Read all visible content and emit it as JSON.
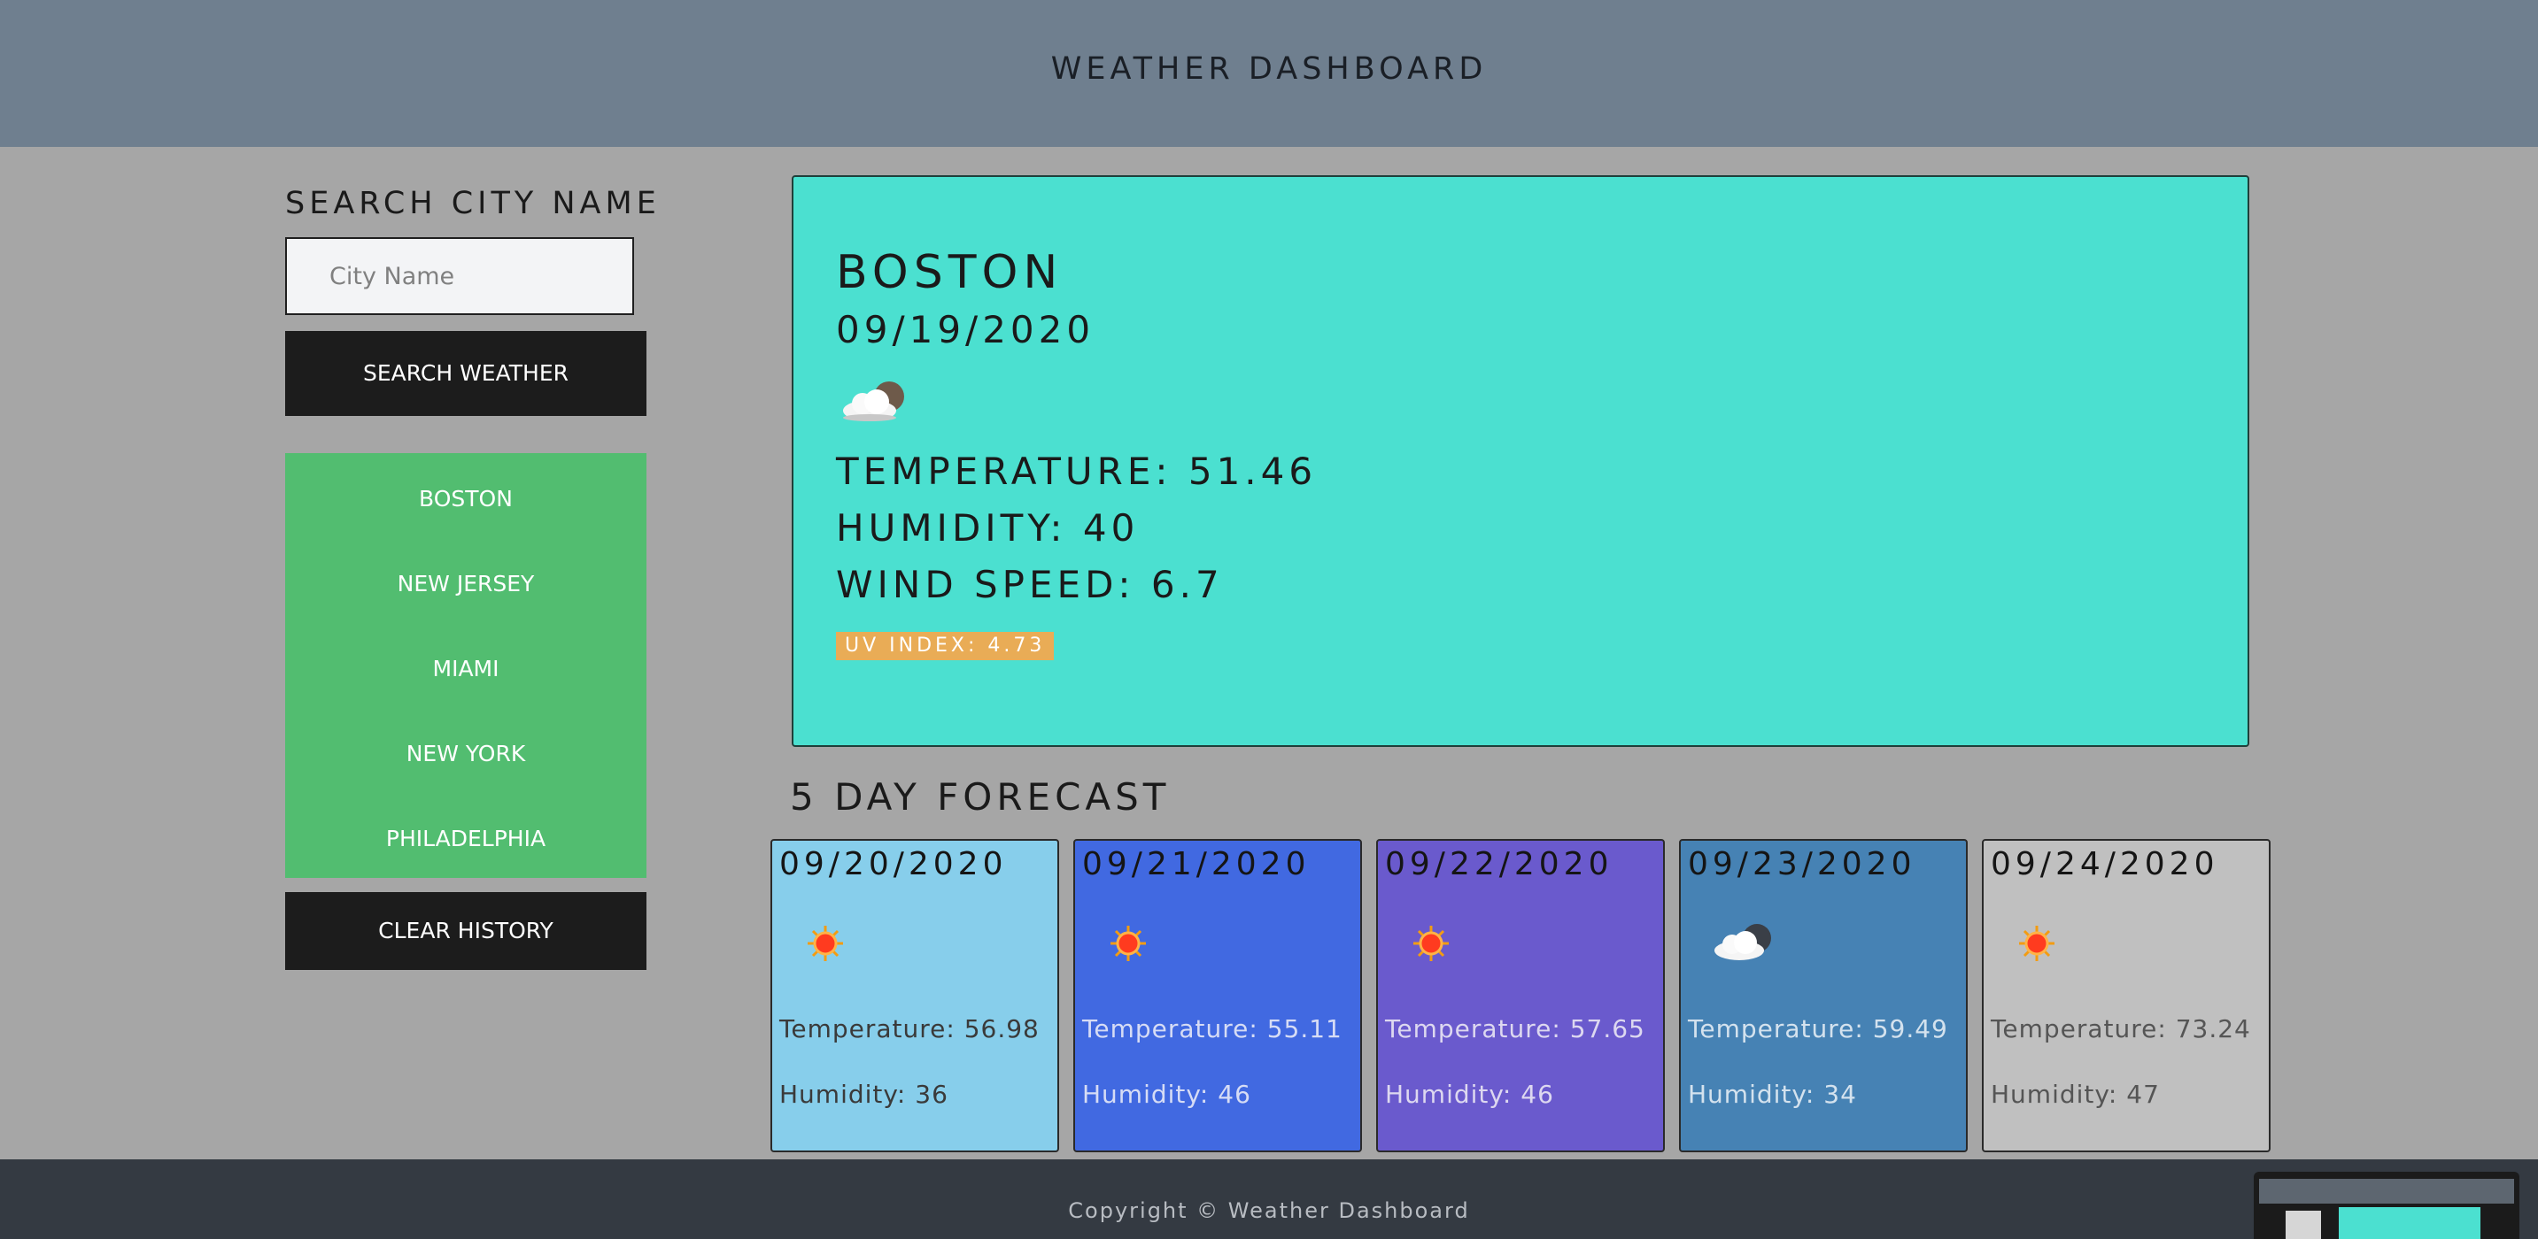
{
  "header": {
    "title": "WEATHER DASHBOARD"
  },
  "search": {
    "label": "SEARCH CITY NAME",
    "placeholder": "City Name",
    "button": "SEARCH WEATHER"
  },
  "history": {
    "items": [
      "BOSTON",
      "NEW JERSEY",
      "MIAMI",
      "NEW YORK",
      "PHILADELPHIA"
    ],
    "clear": "CLEAR HISTORY"
  },
  "current": {
    "city": "BOSTON",
    "date": "09/19/2020",
    "icon": "partly-cloudy-icon",
    "temperature": "TEMPERATURE: 51.46",
    "humidity": "HUMIDITY: 40",
    "wind": "WIND SPEED: 6.7",
    "uv": "UV INDEX: 4.73",
    "uv_color": "#e9ac56",
    "bg_color": "#4be0d0"
  },
  "forecast": {
    "title": "5 DAY FORECAST",
    "days": [
      {
        "date": "09/20/2020",
        "icon": "sun-icon",
        "temp": "Temperature: 56.98",
        "humidity": "Humidity: 36",
        "color": "#87ceeb"
      },
      {
        "date": "09/21/2020",
        "icon": "sun-icon",
        "temp": "Temperature: 55.11",
        "humidity": "Humidity: 46",
        "color": "#4169e1"
      },
      {
        "date": "09/22/2020",
        "icon": "sun-icon",
        "temp": "Temperature: 57.65",
        "humidity": "Humidity: 46",
        "color": "#6a5acd"
      },
      {
        "date": "09/23/2020",
        "icon": "partly-cloudy-icon",
        "temp": "Temperature: 59.49",
        "humidity": "Humidity: 34",
        "color": "#4682b4"
      },
      {
        "date": "09/24/2020",
        "icon": "sun-icon",
        "temp": "Temperature: 73.24",
        "humidity": "Humidity: 47",
        "color": "#c0c0c0"
      }
    ]
  },
  "footer": {
    "text": "Copyright © Weather Dashboard"
  }
}
